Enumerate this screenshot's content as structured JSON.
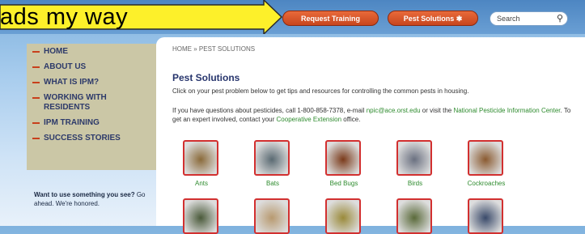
{
  "callout": {
    "text": "ads my way"
  },
  "topnav": {
    "request_training": "Request Training",
    "pest_solutions": "Pest Solutions",
    "search_placeholder": "Search"
  },
  "sidebar": {
    "items": [
      {
        "label": "HOME"
      },
      {
        "label": "ABOUT US"
      },
      {
        "label": "WHAT IS IPM?"
      },
      {
        "label": "WORKING WITH RESIDENTS"
      },
      {
        "label": "IPM TRAINING"
      },
      {
        "label": "SUCCESS STORIES"
      }
    ],
    "promo_bold": "Want to use something you see?",
    "promo_rest": " Go ahead. We're honored."
  },
  "main": {
    "breadcrumb": "HOME  » PEST SOLUTIONS",
    "title": "Pest Solutions",
    "intro": "Click on your pest problem below to get tips and resources for controlling the common pests in housing.",
    "p2_a": "If you have questions about pesticides, call 1-800-858-7378, e-mail ",
    "p2_email": "npic@ace.orst.edu",
    "p2_b": " or visit the ",
    "p2_link1": "National Pesticide Information Center",
    "p2_c": ". To get an expert involved, contact your ",
    "p2_link2": "Cooperative Extension",
    "p2_d": " office."
  },
  "pests": [
    {
      "label": "Ants",
      "icon": "ant-icon",
      "color": "#8a6a3a"
    },
    {
      "label": "Bats",
      "icon": "bat-icon",
      "color": "#5a6a72"
    },
    {
      "label": "Bed Bugs",
      "icon": "bedbug-icon",
      "color": "#7a3a1a"
    },
    {
      "label": "Birds",
      "icon": "bird-icon",
      "color": "#6a7080"
    },
    {
      "label": "Cockroaches",
      "icon": "cockroach-icon",
      "color": "#8a5a30"
    },
    {
      "label": "",
      "icon": "pest-icon",
      "color": "#4a5a3a"
    },
    {
      "label": "",
      "icon": "pest-icon",
      "color": "#b89a70"
    },
    {
      "label": "",
      "icon": "pest-icon",
      "color": "#9a8a3a"
    },
    {
      "label": "",
      "icon": "pest-icon",
      "color": "#5a6a3a"
    },
    {
      "label": "",
      "icon": "pest-icon",
      "color": "#3a4a6a"
    }
  ]
}
